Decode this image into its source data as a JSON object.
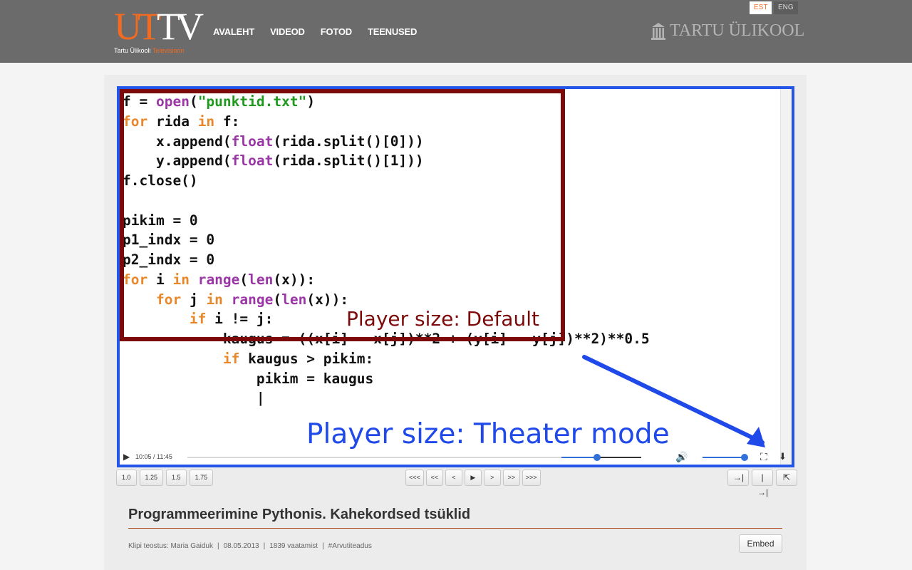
{
  "header": {
    "logo_mark_ut": "UT",
    "logo_mark_tv": "TV",
    "logo_sub_part1": "Tartu Ülikooli",
    "logo_sub_part2": "Televisioon",
    "nav": [
      "AVALEHT",
      "VIDEOD",
      "FOTOD",
      "TEENUSED"
    ],
    "lang_est": "EST",
    "lang_eng": "ENG",
    "university_name": "TARTU ÜLIKOOL"
  },
  "player": {
    "annotation_default": "Player size: Default",
    "annotation_theater": "Player size: Theater mode",
    "annotation_colors": {
      "default": "#7d0a0a",
      "theater": "#1f49e8"
    },
    "time": "10:05 / 11:45",
    "progress": 0.45,
    "volume": 0.95,
    "code_lines": [
      [
        {
          "t": "f = ",
          "c": ""
        },
        {
          "t": "open",
          "c": "fn"
        },
        {
          "t": "(",
          "c": ""
        },
        {
          "t": "\"punktid.txt\"",
          "c": "st"
        },
        {
          "t": ")",
          "c": ""
        }
      ],
      [
        {
          "t": "for",
          "c": "kw"
        },
        {
          "t": " rida ",
          "c": ""
        },
        {
          "t": "in",
          "c": "kw"
        },
        {
          "t": " f:",
          "c": ""
        }
      ],
      [
        {
          "t": "    x.append(",
          "c": ""
        },
        {
          "t": "float",
          "c": "fn"
        },
        {
          "t": "(rida.split()[0]))",
          "c": ""
        }
      ],
      [
        {
          "t": "    y.append(",
          "c": ""
        },
        {
          "t": "float",
          "c": "fn"
        },
        {
          "t": "(rida.split()[1]))",
          "c": ""
        }
      ],
      [
        {
          "t": "f.close()",
          "c": ""
        }
      ],
      [
        {
          "t": "",
          "c": ""
        }
      ],
      [
        {
          "t": "pikim = 0",
          "c": ""
        }
      ],
      [
        {
          "t": "p1_indx = 0",
          "c": ""
        }
      ],
      [
        {
          "t": "p2_indx = 0",
          "c": ""
        }
      ],
      [
        {
          "t": "for",
          "c": "kw"
        },
        {
          "t": " i ",
          "c": ""
        },
        {
          "t": "in",
          "c": "kw"
        },
        {
          "t": " ",
          "c": ""
        },
        {
          "t": "range",
          "c": "fn"
        },
        {
          "t": "(",
          "c": ""
        },
        {
          "t": "len",
          "c": "fn"
        },
        {
          "t": "(x)):",
          "c": ""
        }
      ],
      [
        {
          "t": "    ",
          "c": ""
        },
        {
          "t": "for",
          "c": "kw"
        },
        {
          "t": " j ",
          "c": ""
        },
        {
          "t": "in",
          "c": "kw"
        },
        {
          "t": " ",
          "c": ""
        },
        {
          "t": "range",
          "c": "fn"
        },
        {
          "t": "(",
          "c": ""
        },
        {
          "t": "len",
          "c": "fn"
        },
        {
          "t": "(x)):",
          "c": ""
        }
      ],
      [
        {
          "t": "        ",
          "c": ""
        },
        {
          "t": "if",
          "c": "kw"
        },
        {
          "t": " i != j:",
          "c": ""
        }
      ],
      [
        {
          "t": "            kaugus = ((x[i] - x[j])**2 + (y[i] - y[j])**2)**0.5",
          "c": ""
        }
      ],
      [
        {
          "t": "            ",
          "c": ""
        },
        {
          "t": "if",
          "c": "kw"
        },
        {
          "t": " kaugus > pikim:",
          "c": ""
        }
      ],
      [
        {
          "t": "                pikim = kaugus",
          "c": ""
        }
      ],
      [
        {
          "t": "                |",
          "c": ""
        }
      ]
    ]
  },
  "speed_buttons": [
    "1.0",
    "1.25",
    "1.5",
    "1.75"
  ],
  "nav_buttons": [
    "<<<",
    "<<",
    "<",
    "▶",
    ">",
    ">>",
    ">>>"
  ],
  "size_buttons": {
    "default_icon": "→|",
    "theater_icon": "|→|",
    "popout_icon": "⇱"
  },
  "video_info": {
    "title": "Programmeerimine Pythonis. Kahekordsed tsüklid",
    "author": "Klipi teostus: Maria Gaiduk",
    "date": "08.05.2013",
    "views": "1839 vaatamist",
    "tag": "#Arvutiteadus",
    "separator": "|",
    "embed_label": "Embed"
  }
}
